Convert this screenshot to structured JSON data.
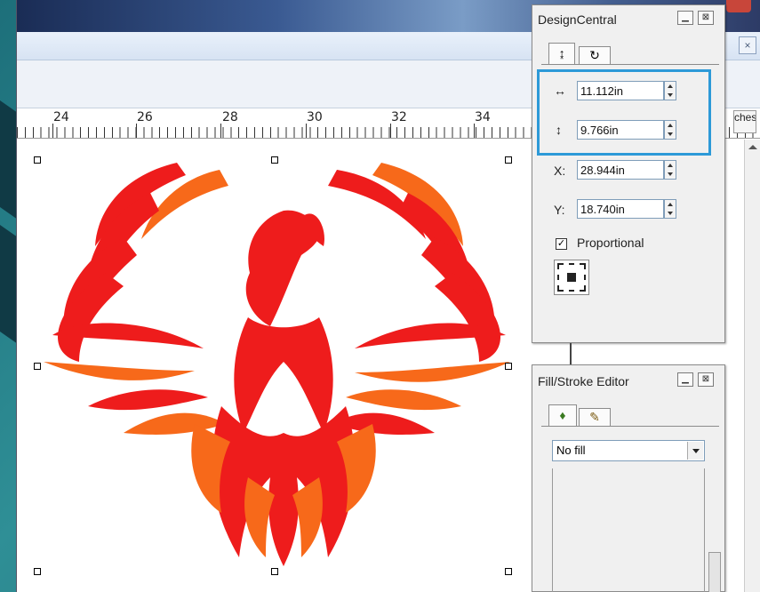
{
  "design_central": {
    "title": "DesignCentral",
    "tab_resize_icon": "resize-icon",
    "tab_rotate_icon": "rotate-icon",
    "width_value": "11.112in",
    "height_value": "9.766in",
    "x_label": "X:",
    "x_value": "28.944in",
    "y_label": "Y:",
    "y_value": "18.740in",
    "proportional_label": "Proportional",
    "proportional_checked": true,
    "anchor_icon": "anchor-grid-icon",
    "highlight_color": "#2d9ad8"
  },
  "fill_stroke": {
    "title": "Fill/Stroke Editor",
    "tab_fill_icon": "paint-bucket-icon",
    "tab_stroke_icon": "pencil-icon",
    "fill_select": "No fill"
  },
  "ruler": {
    "numbers": [
      "24",
      "26",
      "28",
      "30",
      "32",
      "34"
    ],
    "units_label": "ches"
  },
  "artwork": {
    "subject": "phoenix",
    "colors": {
      "red": "#ee1c1c",
      "orange": "#f7691a"
    }
  }
}
